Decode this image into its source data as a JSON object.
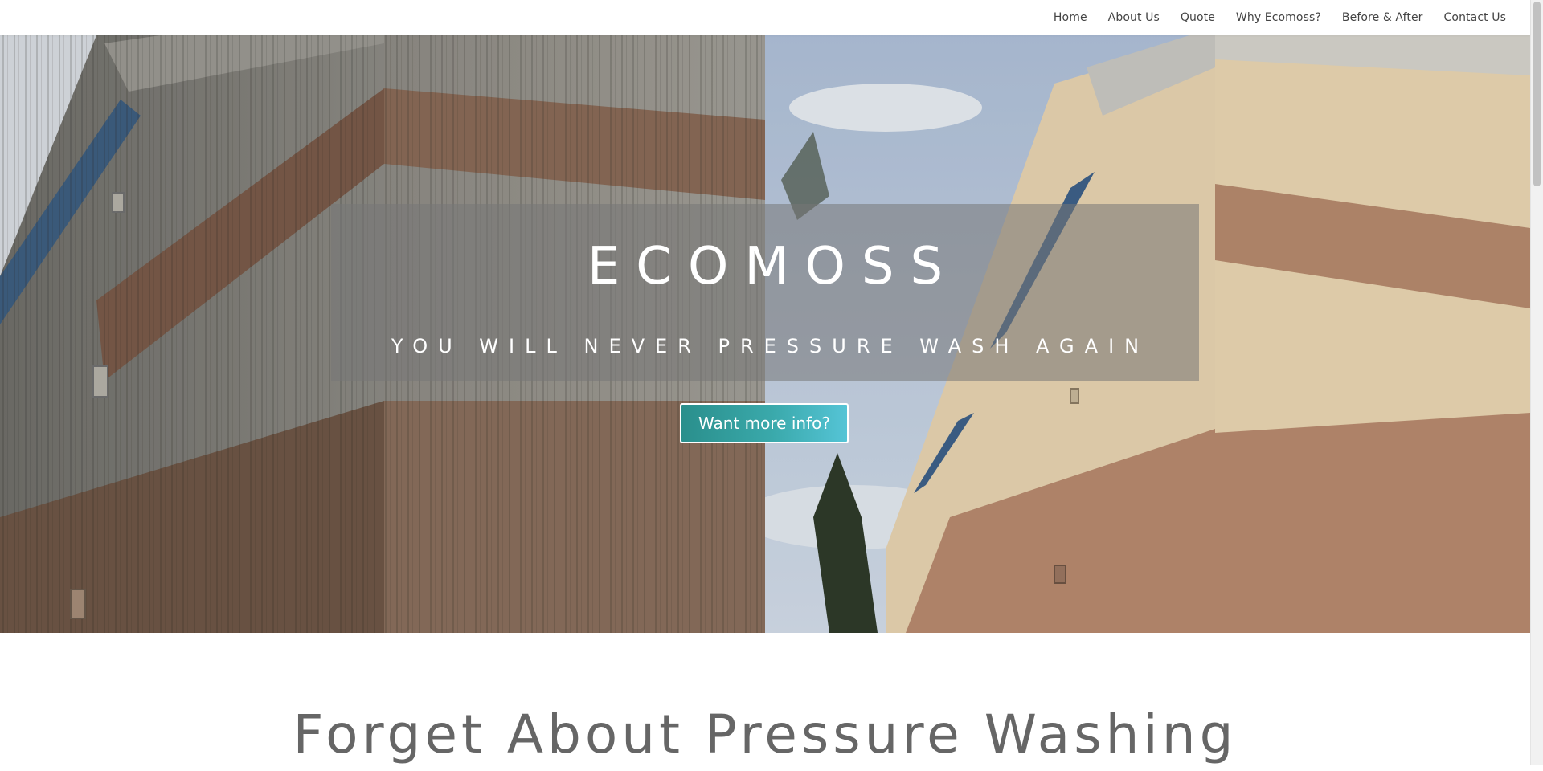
{
  "nav": {
    "items": [
      {
        "label": "Home"
      },
      {
        "label": "About Us"
      },
      {
        "label": "Quote"
      },
      {
        "label": "Why Ecomoss?"
      },
      {
        "label": "Before & After"
      },
      {
        "label": "Contact Us"
      }
    ]
  },
  "hero": {
    "title": "ECOMOSS",
    "subtitle": "YOU WILL NEVER PRESSURE WASH AGAIN",
    "button_label": "Want more info?",
    "button_color": "#3aa9ab"
  },
  "section": {
    "heading": "Forget About Pressure Washing"
  }
}
